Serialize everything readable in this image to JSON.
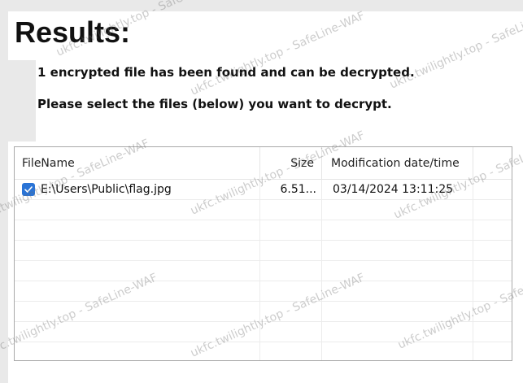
{
  "results": {
    "title": "Results:",
    "message_found": "1 encrypted file has been found and can be decrypted.",
    "message_select": "Please select the files (below) you want to decrypt."
  },
  "file_list": {
    "columns": {
      "filename": "FileName",
      "size": "Size",
      "modified": "Modification date/time"
    },
    "rows": [
      {
        "checked": true,
        "filename": "E:\\Users\\Public\\flag.jpg",
        "size": "6.51...",
        "modified": "03/14/2024 13:11:25"
      }
    ],
    "empty_row_count": 8
  },
  "watermark": {
    "text": "ukfc.twilightly.top - SafeLine-WAF"
  },
  "colors": {
    "checkbox_accent": "#2a74d6",
    "background": "#e9e9e9",
    "panel": "#ffffff"
  }
}
